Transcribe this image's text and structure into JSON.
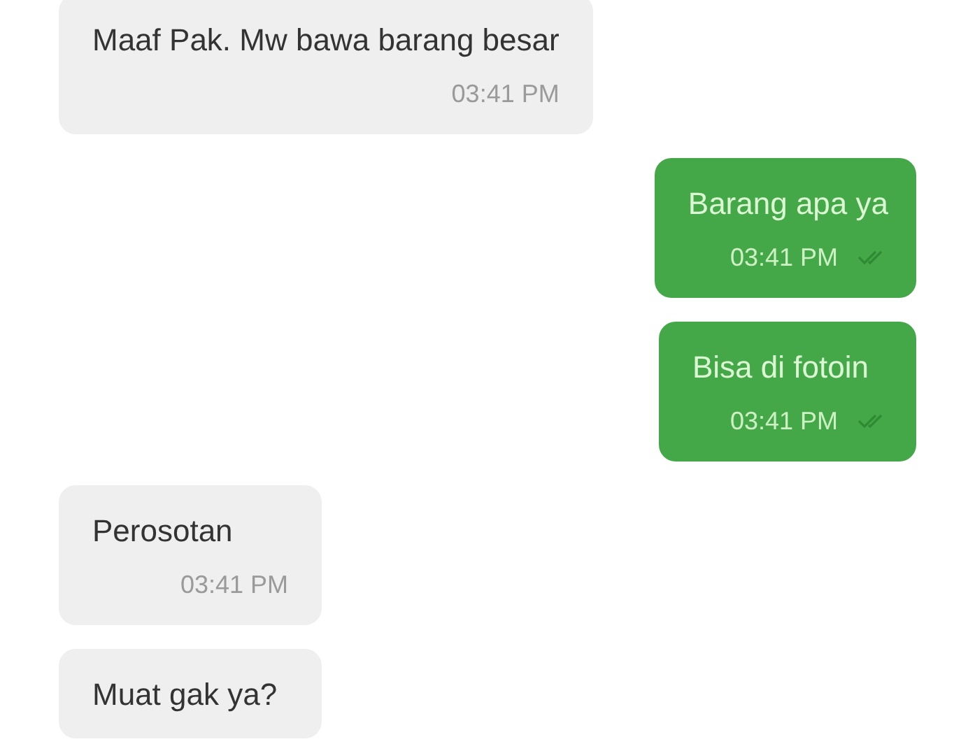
{
  "messages": [
    {
      "kind": "incoming",
      "text": "Maaf Pak. Mw bawa barang besar",
      "time": "03:41 PM"
    },
    {
      "kind": "outgoing",
      "text": "Barang apa ya",
      "time": "03:41 PM",
      "read": true
    },
    {
      "kind": "outgoing",
      "text": "Bisa di fotoin",
      "time": "03:41 PM",
      "read": true
    },
    {
      "kind": "incoming",
      "text": "Perosotan",
      "time": "03:41 PM"
    },
    {
      "kind": "incoming",
      "text": "Muat gak ya?"
    }
  ]
}
